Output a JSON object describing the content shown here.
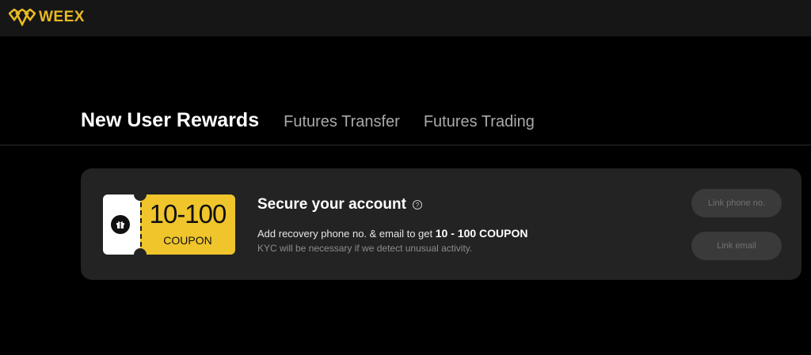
{
  "header": {
    "logo_text": "WEEX",
    "brand_color": "#e8b923"
  },
  "tabs": [
    {
      "label": "New User Rewards",
      "active": true
    },
    {
      "label": "Futures Transfer",
      "active": false
    },
    {
      "label": "Futures Trading",
      "active": false
    }
  ],
  "card": {
    "coupon_amount": "10-100",
    "coupon_label": "COUPON",
    "title": "Secure your account",
    "help_icon": "?",
    "description_prefix": "Add recovery phone no. & email to get",
    "description_highlight": "10 - 100 COUPON",
    "note": "KYC will be necessary if we detect unusual activity.",
    "buttons": {
      "phone": "Link phone no.",
      "email": "Link email"
    }
  }
}
